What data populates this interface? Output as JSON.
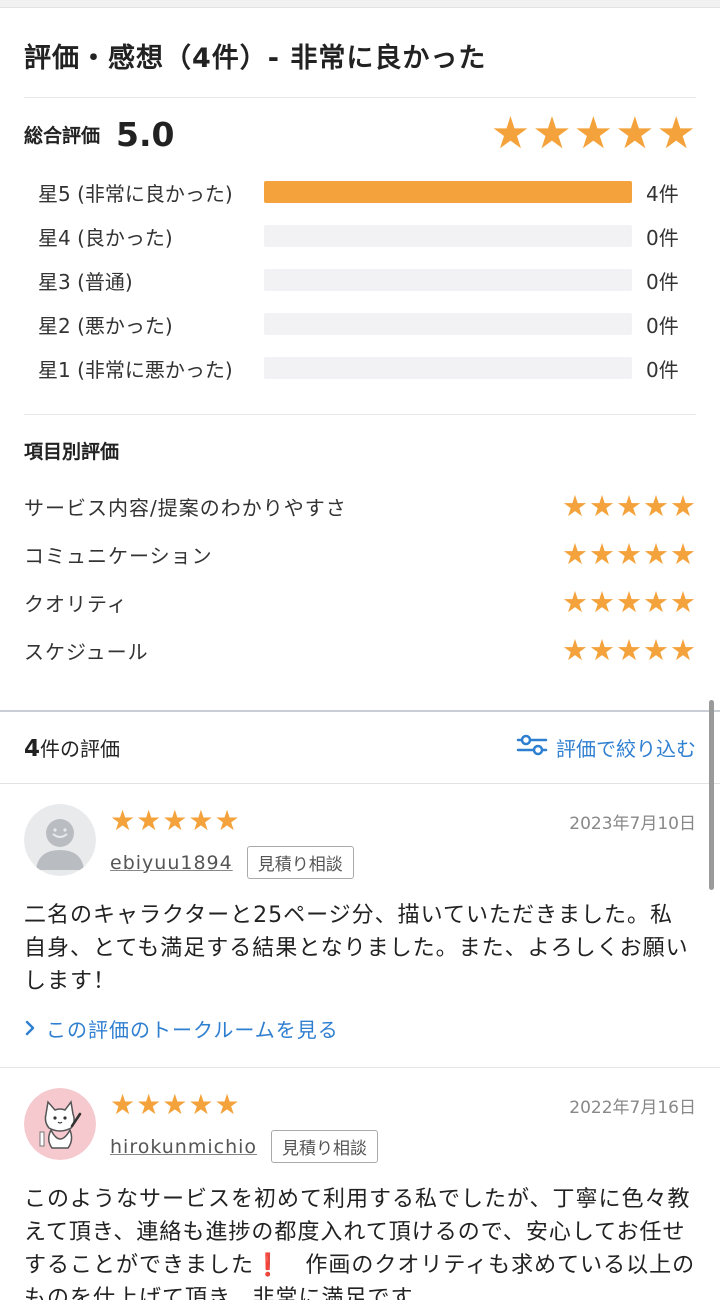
{
  "summary": {
    "title": "評価・感想（4件）- 非常に良かった",
    "overall_label": "総合評価",
    "overall_score": "5.0",
    "overall_stars": 5,
    "distribution": [
      {
        "label": "星5 (非常に良かった)",
        "count": "4件",
        "fraction": 1.0
      },
      {
        "label": "星4 (良かった)",
        "count": "0件",
        "fraction": 0
      },
      {
        "label": "星3 (普通)",
        "count": "0件",
        "fraction": 0
      },
      {
        "label": "星2 (悪かった)",
        "count": "0件",
        "fraction": 0
      },
      {
        "label": "星1 (非常に悪かった)",
        "count": "0件",
        "fraction": 0
      }
    ],
    "items_heading": "項目別評価",
    "items": [
      {
        "label": "サービス内容/提案のわかりやすさ",
        "stars": 5
      },
      {
        "label": "コミュニケーション",
        "stars": 5
      },
      {
        "label": "クオリティ",
        "stars": 5
      },
      {
        "label": "スケジュール",
        "stars": 5
      }
    ]
  },
  "reviews_header": {
    "count_number": "4",
    "count_suffix": "件の評価",
    "filter_label": "評価で絞り込む",
    "filter_icon": "sliders-icon"
  },
  "reviews": [
    {
      "stars": 5,
      "date": "2023年7月10日",
      "username": "ebiyuu1894",
      "tag": "見積り相談",
      "avatar": "default-user-avatar",
      "body": "二名のキャラクターと25ページ分、描いていただきました。私自身、とても満足する結果となりました。また、よろしくお願いします！",
      "link_label": "この評価のトークルームを見る"
    },
    {
      "stars": 5,
      "date": "2022年7月16日",
      "username": "hirokunmichio",
      "tag": "見積り相談",
      "avatar": "cat-illustration-avatar",
      "body_part1": "このようなサービスを初めて利用する私でしたが、丁寧に色々教えて頂き、連絡も進捗の都度入れて頂けるので、安心してお任せすることができました",
      "body_mark": "❗",
      "body_part2": "　作画のクオリティも求めている以上のものを仕上げて頂き、非常に満足です"
    }
  ],
  "colors": {
    "star": "#f4a23b",
    "link": "#2f7fd1",
    "bar_track": "#f2f2f4",
    "accent_mark": "#e03a2f"
  }
}
